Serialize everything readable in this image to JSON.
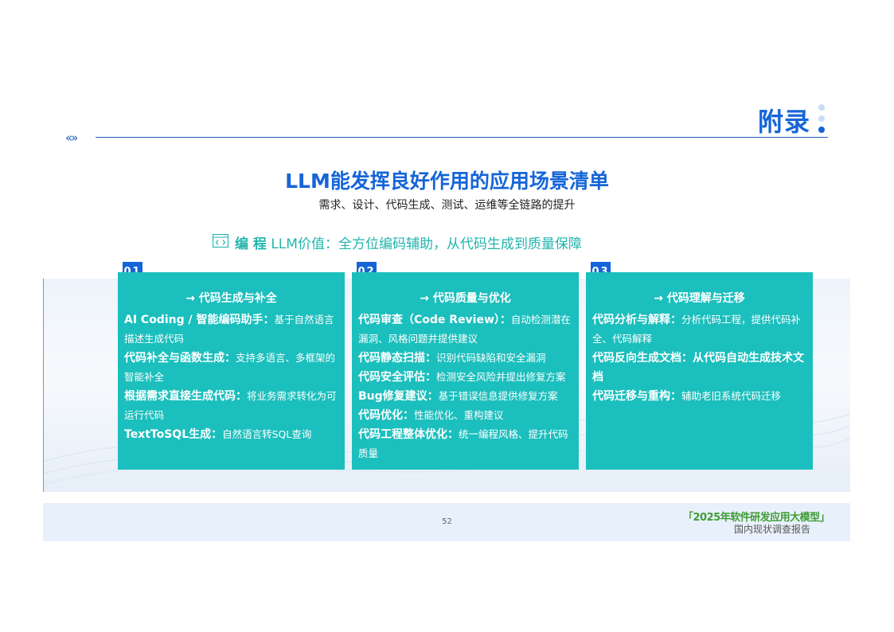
{
  "header": {
    "appendix_title": "附录",
    "nav_chevrons": "«»"
  },
  "title": {
    "main": "LLM能发挥良好作用的应用场景清单",
    "sub": "需求、设计、代码生成、测试、运维等全链路的提升"
  },
  "programming": {
    "icon": "code-icon",
    "label": "编 程",
    "value": "LLM价值：全方位编码辅助，从代码生成到质量保障"
  },
  "colors": {
    "accent_blue": "#1565d8",
    "card_teal": "#1bbfbd",
    "teal_text": "#21b5ad",
    "footer_green": "#3f9c35"
  },
  "cards": [
    {
      "badge": "01",
      "title": "→ 代码生成与补全",
      "items": [
        {
          "k": "AI Coding / 智能编码助手：",
          "v": "基于自然语言描述生成代码"
        },
        {
          "k": "代码补全与函数生成：",
          "v": "支持多语言、多框架的智能补全"
        },
        {
          "k": "根据需求直接生成代码：",
          "v": "将业务需求转化为可运行代码"
        },
        {
          "k": "TextToSQL生成：",
          "v": "自然语言转SQL查询"
        }
      ]
    },
    {
      "badge": "02",
      "title": "→ 代码质量与优化",
      "items": [
        {
          "k": "代码审查（Code Review）：",
          "v": "自动检测潜在漏洞、风格问题并提供建议"
        },
        {
          "k": "代码静态扫描：",
          "v": "识别代码缺陷和安全漏洞"
        },
        {
          "k": "代码安全评估：",
          "v": "检测安全风险并提出修复方案"
        },
        {
          "k": "Bug修复建议：",
          "v": "基于错误信息提供修复方案"
        },
        {
          "k": "代码优化：",
          "v": "性能优化、重构建议"
        },
        {
          "k": "代码工程整体优化：",
          "v": "统一编程风格、提升代码质量"
        }
      ]
    },
    {
      "badge": "03",
      "title": "→ 代码理解与迁移",
      "items": [
        {
          "k": "代码分析与解释：",
          "v": "分析代码工程，提供代码补全、代码解释"
        },
        {
          "k": "代码反向生成文档：从代码自动生成技术文档",
          "v": ""
        },
        {
          "k": "代码迁移与重构：",
          "v": "辅助老旧系统代码迁移"
        }
      ]
    }
  ],
  "footer": {
    "page_number": "52",
    "report_title": "「2025年软件研发应用大模型」",
    "report_sub": "国内现状调查报告"
  }
}
